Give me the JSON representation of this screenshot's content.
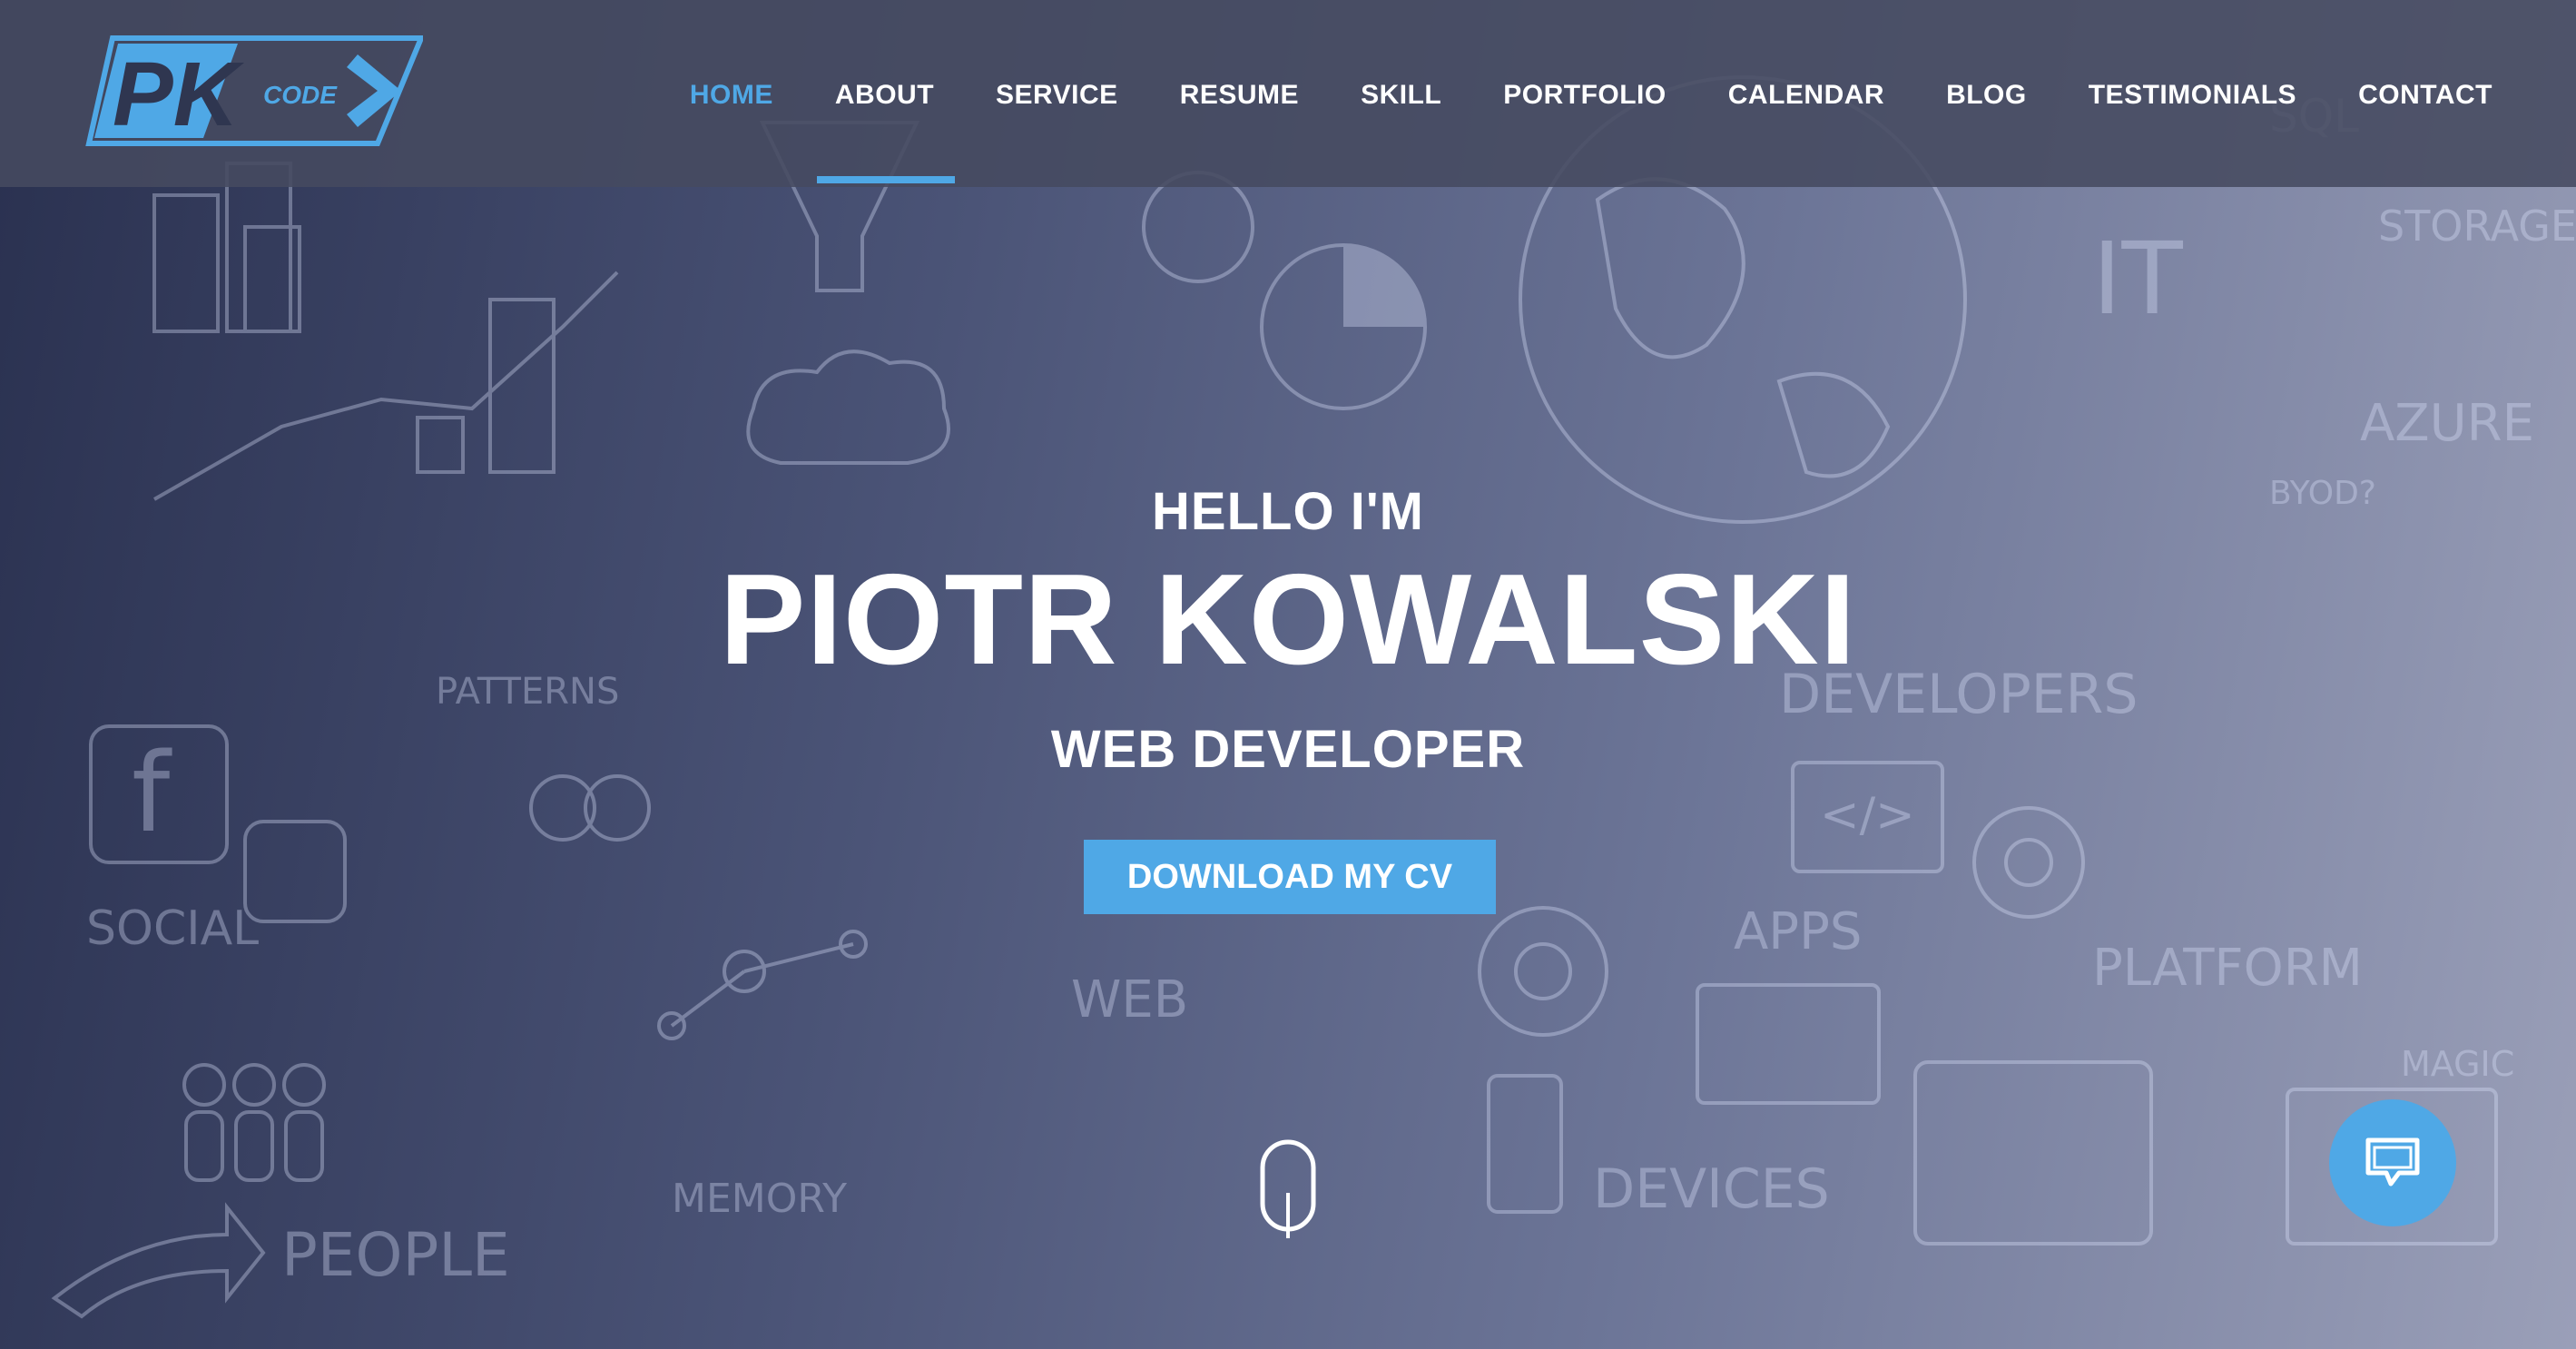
{
  "logo": {
    "letters": "PK",
    "sub_text": "CODE",
    "accent_color": "#4fa8e6"
  },
  "nav": {
    "items": [
      {
        "label": "HOME",
        "active": true
      },
      {
        "label": "ABOUT",
        "active": false
      },
      {
        "label": "SERVICE",
        "active": false
      },
      {
        "label": "RESUME",
        "active": false
      },
      {
        "label": "SKILL",
        "active": false
      },
      {
        "label": "PORTFOLIO",
        "active": false
      },
      {
        "label": "CALENDAR",
        "active": false
      },
      {
        "label": "BLOG",
        "active": false
      },
      {
        "label": "TESTIMONIALS",
        "active": false
      },
      {
        "label": "CONTACT",
        "active": false
      }
    ]
  },
  "hero": {
    "greeting": "HELLO I'M",
    "name": "PIOTR KOWALSKI",
    "role": "WEB DEVELOPER",
    "cta_label": "DOWNLOAD MY CV"
  },
  "background_sketch": {
    "words": [
      "SOCIAL",
      "PEOPLE",
      "PATTERNS",
      "MEMORY",
      "WEB",
      "APPS",
      "DEVELOPERS",
      "DEVICES",
      "PLATFORM",
      "AZURE",
      "STORAGE",
      "BYOD?",
      "IT",
      "SQL",
      "MAGIC",
      "CLOUD"
    ]
  },
  "icons": {
    "scroll": "mouse-scroll-icon",
    "chat": "chat-bubble-icon"
  },
  "colors": {
    "accent": "#4fa8e6",
    "header_bg": "#464a60",
    "text": "#ffffff"
  }
}
